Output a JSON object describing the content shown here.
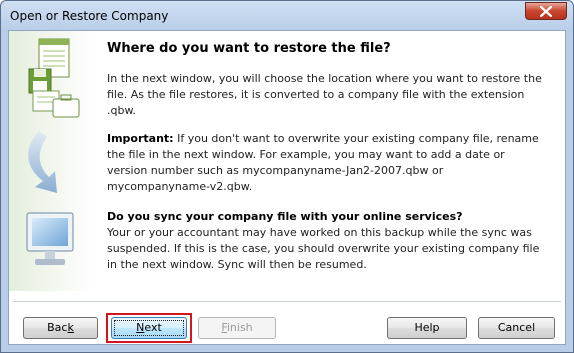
{
  "window": {
    "title": "Open or Restore Company"
  },
  "content": {
    "heading": "Where do you want to restore the file?",
    "p1": "In the next window, you will choose the location where you want to restore the file. As the file restores, it is converted to a company file with the extension .qbw.",
    "p2_bold": "Important:",
    "p2": " If you don't want to overwrite your existing company file, rename the file in the next window. For example, you may want to add a date or version number such as mycompanyname-Jan2-2007.qbw or mycompanyname-v2.qbw.",
    "p3_bold": "Do you sync your company file with your online services?",
    "p3": "Your or your accountant may have worked on this backup while the sync was suspended. If this is the case, you should overwrite your existing company file in the next window. Sync will then be resumed."
  },
  "buttons": {
    "back_pre": "Bac",
    "back_u": "k",
    "back_post": "",
    "next_pre": "",
    "next_u": "N",
    "next_post": "ext",
    "finish_pre": "",
    "finish_u": "F",
    "finish_post": "inish",
    "help": "Help",
    "cancel": "Cancel"
  },
  "colors": {
    "highlight": "#d6141d",
    "accent": "#3c7fb1"
  }
}
